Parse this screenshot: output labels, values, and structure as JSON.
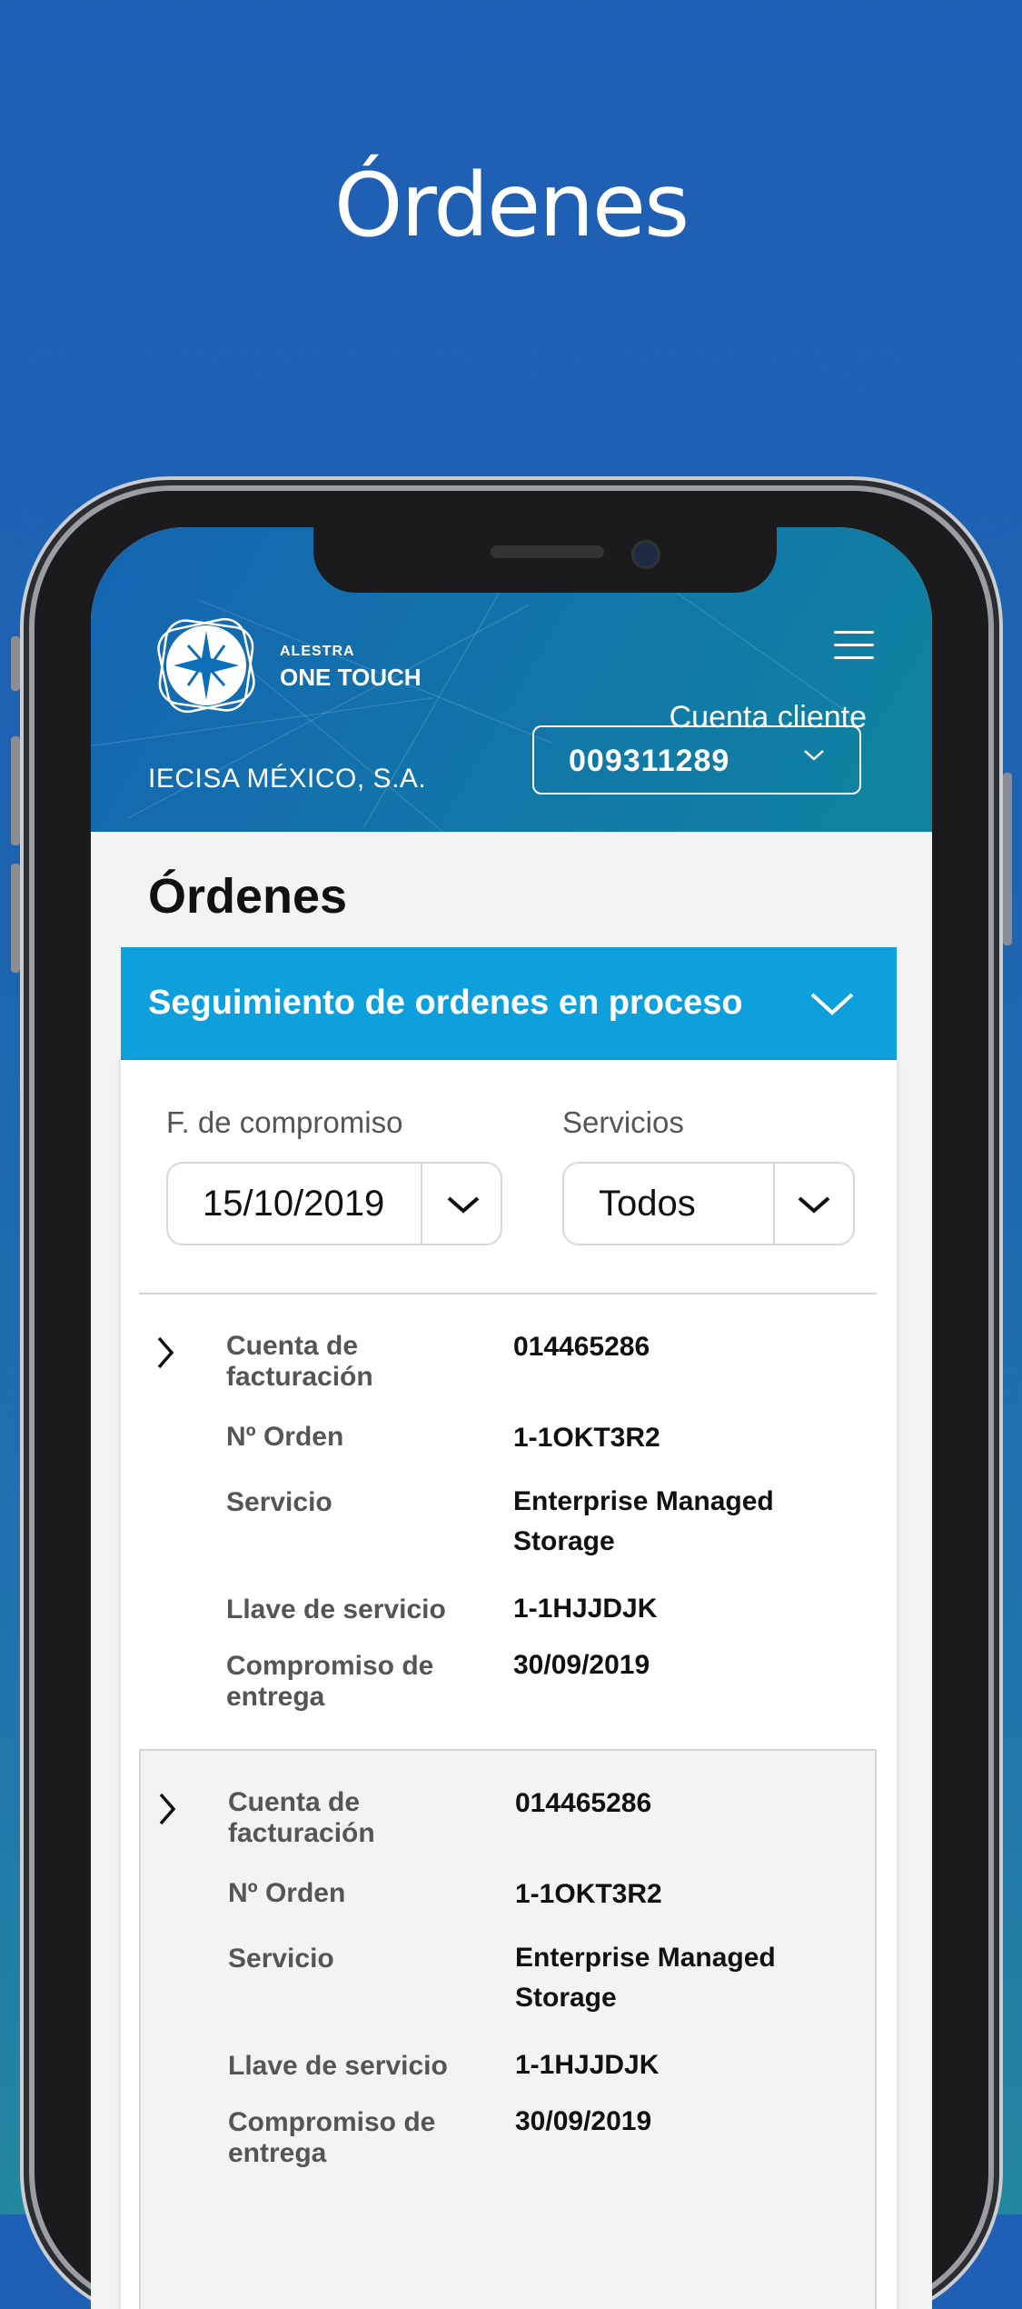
{
  "marketing": {
    "title": "Órdenes"
  },
  "header": {
    "brand_small": "ALESTRA",
    "brand_big": "ONE TOUCH",
    "cuenta_label": "Cuenta cliente",
    "account_value": "009311289",
    "company": "IECISA MÉXICO, S.A."
  },
  "page": {
    "title": "Órdenes"
  },
  "accordion": {
    "label": "Seguimiento de ordenes en proceso"
  },
  "filters": {
    "date_label": "F. de compromiso",
    "date_value": "15/10/2019",
    "services_label": "Servicios",
    "services_value": "Todos"
  },
  "orders": [
    {
      "labels": {
        "cuenta": "Cuenta de facturación",
        "orden": "Nº Orden",
        "servicio": "Servicio",
        "llave": "Llave de servicio",
        "compromiso": "Compromiso de entrega"
      },
      "cuenta": "014465286",
      "orden": "1-1OKT3R2",
      "servicio": "Enterprise Managed Storage",
      "llave": "1-1HJJDJK",
      "compromiso": "30/09/2019"
    },
    {
      "labels": {
        "cuenta": "Cuenta de facturación",
        "orden": "Nº Orden",
        "servicio": "Servicio",
        "llave": "Llave de servicio",
        "compromiso": "Compromiso de entrega"
      },
      "cuenta": "014465286",
      "orden": "1-1OKT3R2",
      "servicio": "Enterprise Managed Storage",
      "llave": "1-1HJJDJK",
      "compromiso": "30/09/2019"
    }
  ]
}
